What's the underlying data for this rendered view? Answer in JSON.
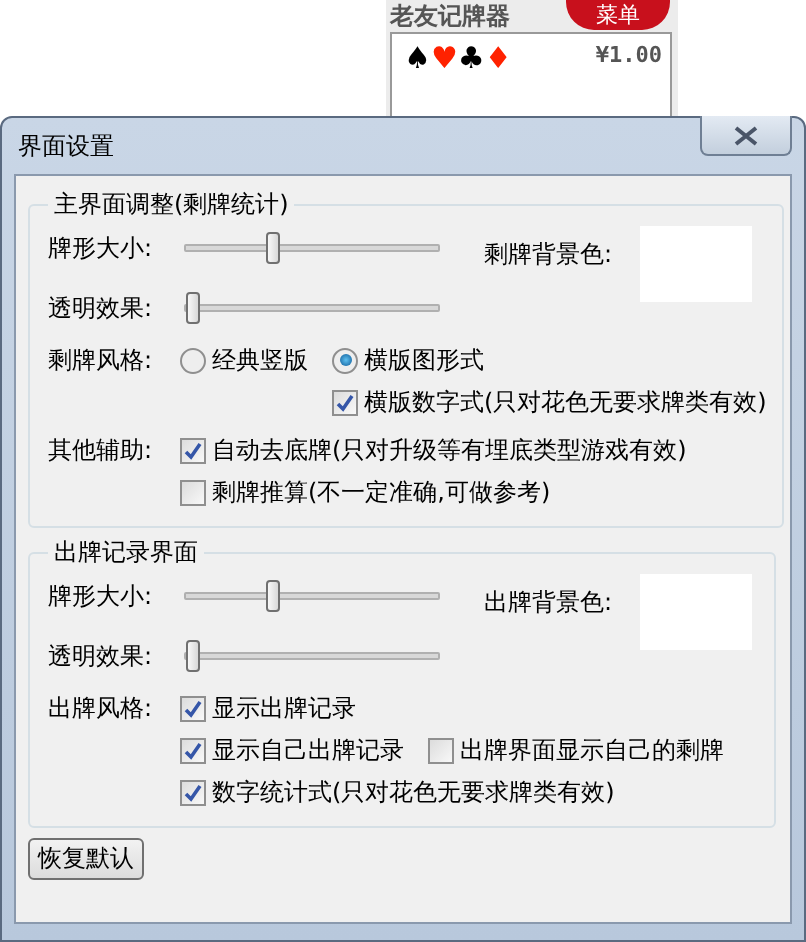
{
  "background_app": {
    "title": "老友记牌器",
    "menu_button": "菜单",
    "suits": [
      {
        "symbol": "♠",
        "color": "#000000"
      },
      {
        "symbol": "♥",
        "color": "#ff2200"
      },
      {
        "symbol": "♣",
        "color": "#000000"
      },
      {
        "symbol": "♦",
        "color": "#ff2200"
      }
    ],
    "amount": "¥1.00"
  },
  "dialog": {
    "title": "界面设置"
  },
  "sections": [
    {
      "title": "主界面调整(剩牌统计)",
      "sliders": [
        {
          "label": "牌形大小:",
          "level": 0.34
        },
        {
          "label": "透明效果:",
          "level": 0.02
        }
      ],
      "swatch_label": "剩牌背景色:",
      "groups": [
        {
          "label": "剩牌风格:",
          "lines": [
            [
              {
                "kind": "radio",
                "text": "经典竖版",
                "selected": false
              },
              {
                "kind": "radio",
                "text": "横版图形式",
                "selected": true,
                "children": [
                  {
                    "kind": "checkbox",
                    "text": "横版数字式(只对花色无要求牌类有效)",
                    "checked": true
                  }
                ]
              }
            ]
          ]
        },
        {
          "label": "其他辅助:",
          "lines": [
            [
              {
                "kind": "checkbox",
                "text": "自动去底牌(只对升级等有埋底类型游戏有效)",
                "checked": true
              }
            ],
            [
              {
                "kind": "checkbox",
                "text": "剩牌推算(不一定准确,可做参考)",
                "checked": false
              }
            ]
          ]
        }
      ]
    },
    {
      "title": "出牌记录界面",
      "sliders": [
        {
          "label": "牌形大小:",
          "level": 0.34
        },
        {
          "label": "透明效果:",
          "level": 0.02
        }
      ],
      "swatch_label": "出牌背景色:",
      "groups": [
        {
          "label": "出牌风格:",
          "lines": [
            [
              {
                "kind": "checkbox",
                "text": "显示出牌记录",
                "checked": true
              }
            ],
            [
              {
                "kind": "checkbox",
                "text": "显示自己出牌记录",
                "checked": true
              },
              {
                "kind": "checkbox",
                "text": "出牌界面显示自己的剩牌",
                "checked": false
              }
            ],
            [
              {
                "kind": "checkbox",
                "text": "数字统计式(只对花色无要求牌类有效)",
                "checked": true
              }
            ]
          ]
        }
      ]
    }
  ],
  "reset_button": "恢复默认"
}
